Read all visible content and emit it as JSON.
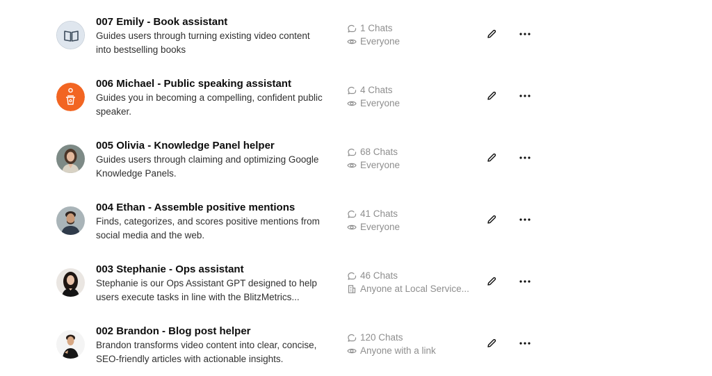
{
  "gpts": [
    {
      "name": "007 Emily - Book assistant",
      "description": "Guides users through turning existing video content into bestselling books",
      "chats": "1 Chats",
      "access": "Everyone",
      "access_icon": "eye-icon",
      "avatar_icon": "book-icon"
    },
    {
      "name": "006 Michael - Public speaking assistant",
      "description": "Guides you in becoming a compelling, confident public speaker.",
      "chats": "4 Chats",
      "access": "Everyone",
      "access_icon": "eye-icon",
      "avatar_icon": "podium-icon"
    },
    {
      "name": "005 Olivia - Knowledge Panel helper",
      "description": "Guides users through claiming and optimizing Google Knowledge Panels.",
      "chats": "68 Chats",
      "access": "Everyone",
      "access_icon": "eye-icon",
      "avatar_icon": "portrait"
    },
    {
      "name": "004 Ethan - Assemble positive mentions",
      "description": "Finds, categorizes, and scores positive mentions from social media and the web.",
      "chats": "41 Chats",
      "access": "Everyone",
      "access_icon": "eye-icon",
      "avatar_icon": "portrait"
    },
    {
      "name": "003 Stephanie - Ops assistant",
      "description": "Stephanie is our Ops Assistant GPT designed to help users execute tasks in line with the BlitzMetrics...",
      "chats": "46 Chats",
      "access": "Anyone at Local Service...",
      "access_icon": "building-icon",
      "avatar_icon": "portrait"
    },
    {
      "name": "002 Brandon - Blog post helper",
      "description": "Brandon transforms video content into clear, concise, SEO-friendly articles with actionable insights.",
      "chats": "120 Chats",
      "access": "Anyone with a link",
      "access_icon": "eye-icon",
      "avatar_icon": "portrait"
    }
  ],
  "colors": {
    "title": "#0d0d0d",
    "description": "#2f2f2f",
    "meta": "#8e8e8e",
    "accent_orange": "#f26522",
    "book_avatar_bg": "#d9e1ea"
  }
}
